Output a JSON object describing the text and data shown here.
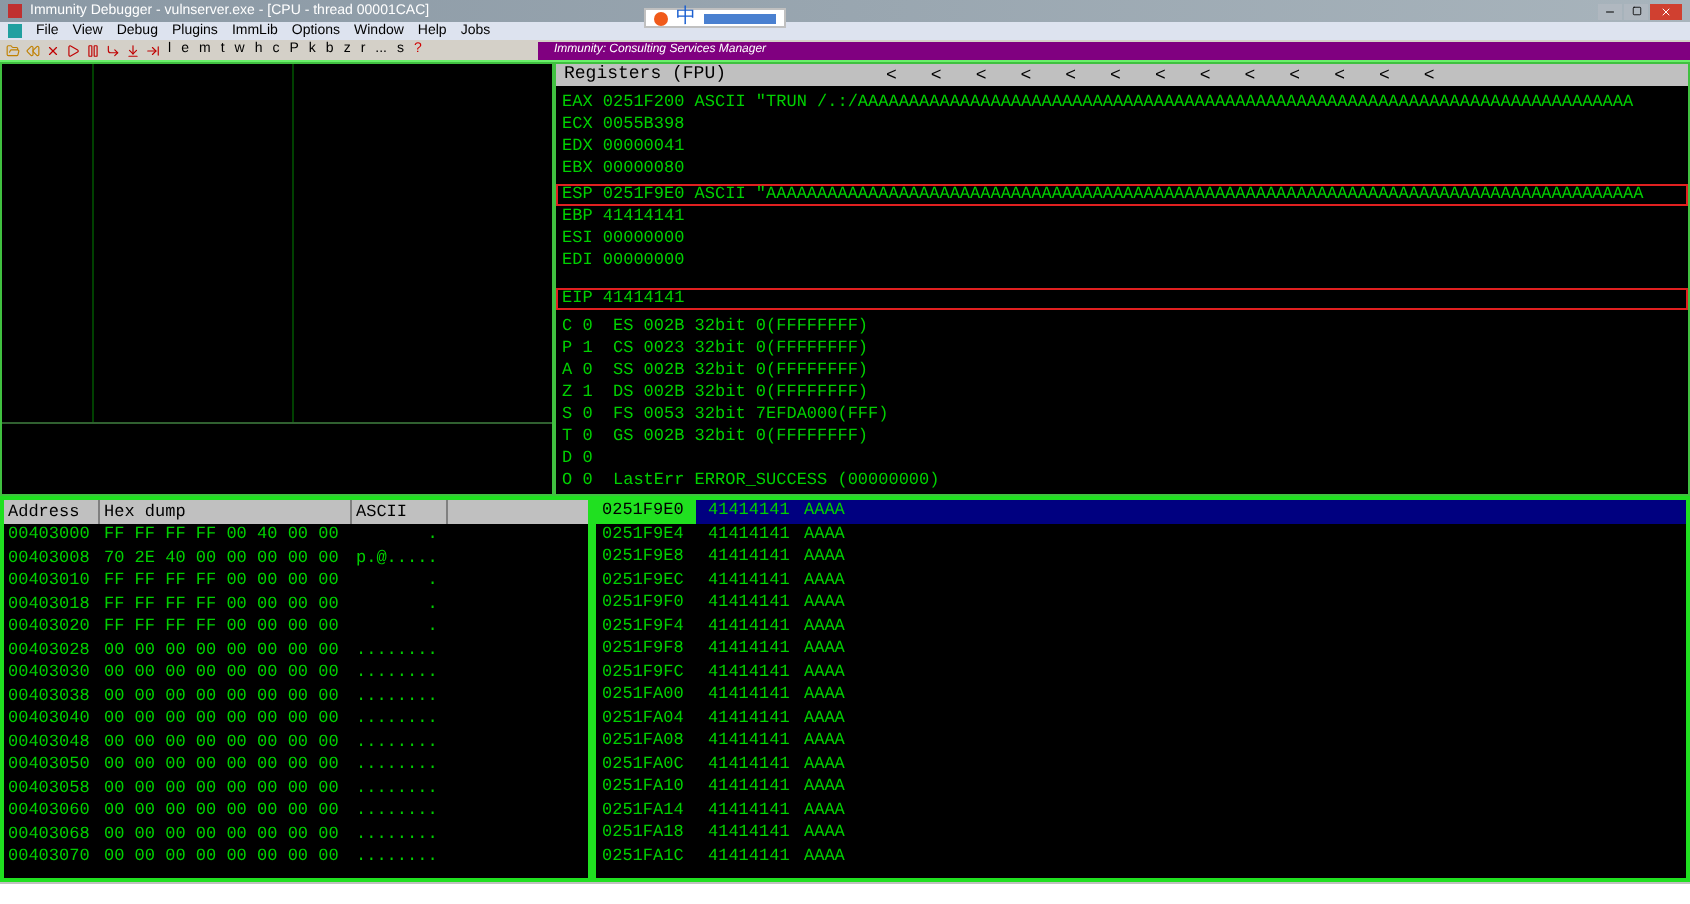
{
  "window": {
    "title": "Immunity Debugger - vulnserver.exe - [CPU - thread 00001CAC]"
  },
  "ime_toolbar": {
    "label": "中"
  },
  "menu": [
    "File",
    "View",
    "Debug",
    "Plugins",
    "ImmLib",
    "Options",
    "Window",
    "Help",
    "Jobs"
  ],
  "toolbar": {
    "letters": [
      "l",
      "e",
      "m",
      "t",
      "w",
      "h",
      "c",
      "P",
      "k",
      "b",
      "z",
      "r",
      "...",
      "s",
      "?"
    ],
    "banner": "Immunity: Consulting Services Manager"
  },
  "registers": {
    "title": "Registers (FPU)",
    "arrows": [
      "<",
      "<",
      "<",
      "<",
      "<",
      "<",
      "<",
      "<",
      "<",
      "<",
      "<",
      "<",
      "<"
    ],
    "rows": [
      {
        "text": "EAX 0251F200 ASCII \"TRUN /.:/AAAAAAAAAAAAAAAAAAAAAAAAAAAAAAAAAAAAAAAAAAAAAAAAAAAAAAAAAAAAAAAAAAAAAAAAAAAA",
        "highlighted": false
      },
      {
        "text": "ECX 0055B398",
        "highlighted": false
      },
      {
        "text": "EDX 00000041",
        "highlighted": false
      },
      {
        "text": "EBX 00000080",
        "highlighted": false
      },
      {
        "text": "ESP 0251F9E0 ASCII \"AAAAAAAAAAAAAAAAAAAAAAAAAAAAAAAAAAAAAAAAAAAAAAAAAAAAAAAAAAAAAAAAAAAAAAAAAAAAAAAAAAAAAA",
        "highlighted": true
      },
      {
        "text": "EBP 41414141",
        "highlighted": false
      },
      {
        "text": "ESI 00000000",
        "highlighted": false
      },
      {
        "text": "EDI 00000000",
        "highlighted": false
      }
    ],
    "eip": {
      "text": "EIP 41414141",
      "highlighted": true
    },
    "flags": [
      "C 0  ES 002B 32bit 0(FFFFFFFF)",
      "P 1  CS 0023 32bit 0(FFFFFFFF)",
      "A 0  SS 002B 32bit 0(FFFFFFFF)",
      "Z 1  DS 002B 32bit 0(FFFFFFFF)",
      "S 0  FS 0053 32bit 7EFDA000(FFF)",
      "T 0  GS 002B 32bit 0(FFFFFFFF)",
      "D 0",
      "O 0  LastErr ERROR_SUCCESS (00000000)"
    ]
  },
  "dump": {
    "columns": [
      "Address",
      "Hex dump",
      "ASCII"
    ],
    "rows": [
      {
        "address": "00403000",
        "hex": "FF FF FF FF 00 40 00 00",
        "ascii": "       ."
      },
      {
        "address": "00403008",
        "hex": "70 2E 40 00 00 00 00 00",
        "ascii": "p.@....."
      },
      {
        "address": "00403010",
        "hex": "FF FF FF FF 00 00 00 00",
        "ascii": "       ."
      },
      {
        "address": "00403018",
        "hex": "FF FF FF FF 00 00 00 00",
        "ascii": "       ."
      },
      {
        "address": "00403020",
        "hex": "FF FF FF FF 00 00 00 00",
        "ascii": "       ."
      },
      {
        "address": "00403028",
        "hex": "00 00 00 00 00 00 00 00",
        "ascii": "........"
      },
      {
        "address": "00403030",
        "hex": "00 00 00 00 00 00 00 00",
        "ascii": "........"
      },
      {
        "address": "00403038",
        "hex": "00 00 00 00 00 00 00 00",
        "ascii": "........"
      },
      {
        "address": "00403040",
        "hex": "00 00 00 00 00 00 00 00",
        "ascii": "........"
      },
      {
        "address": "00403048",
        "hex": "00 00 00 00 00 00 00 00",
        "ascii": "........"
      },
      {
        "address": "00403050",
        "hex": "00 00 00 00 00 00 00 00",
        "ascii": "........"
      },
      {
        "address": "00403058",
        "hex": "00 00 00 00 00 00 00 00",
        "ascii": "........"
      },
      {
        "address": "00403060",
        "hex": "00 00 00 00 00 00 00 00",
        "ascii": "........"
      },
      {
        "address": "00403068",
        "hex": "00 00 00 00 00 00 00 00",
        "ascii": "........"
      },
      {
        "address": "00403070",
        "hex": "00 00 00 00 00 00 00 00",
        "ascii": "........"
      }
    ]
  },
  "stack": {
    "rows": [
      {
        "address": "0251F9E0",
        "value": "41414141",
        "ascii": "AAAA",
        "selected": true
      },
      {
        "address": "0251F9E4",
        "value": "41414141",
        "ascii": "AAAA",
        "selected": false
      },
      {
        "address": "0251F9E8",
        "value": "41414141",
        "ascii": "AAAA",
        "selected": false
      },
      {
        "address": "0251F9EC",
        "value": "41414141",
        "ascii": "AAAA",
        "selected": false
      },
      {
        "address": "0251F9F0",
        "value": "41414141",
        "ascii": "AAAA",
        "selected": false
      },
      {
        "address": "0251F9F4",
        "value": "41414141",
        "ascii": "AAAA",
        "selected": false
      },
      {
        "address": "0251F9F8",
        "value": "41414141",
        "ascii": "AAAA",
        "selected": false
      },
      {
        "address": "0251F9FC",
        "value": "41414141",
        "ascii": "AAAA",
        "selected": false
      },
      {
        "address": "0251FA00",
        "value": "41414141",
        "ascii": "AAAA",
        "selected": false
      },
      {
        "address": "0251FA04",
        "value": "41414141",
        "ascii": "AAAA",
        "selected": false
      },
      {
        "address": "0251FA08",
        "value": "41414141",
        "ascii": "AAAA",
        "selected": false
      },
      {
        "address": "0251FA0C",
        "value": "41414141",
        "ascii": "AAAA",
        "selected": false
      },
      {
        "address": "0251FA10",
        "value": "41414141",
        "ascii": "AAAA",
        "selected": false
      },
      {
        "address": "0251FA14",
        "value": "41414141",
        "ascii": "AAAA",
        "selected": false
      },
      {
        "address": "0251FA18",
        "value": "41414141",
        "ascii": "AAAA",
        "selected": false
      },
      {
        "address": "0251FA1C",
        "value": "41414141",
        "ascii": "AAAA",
        "selected": false
      }
    ]
  }
}
